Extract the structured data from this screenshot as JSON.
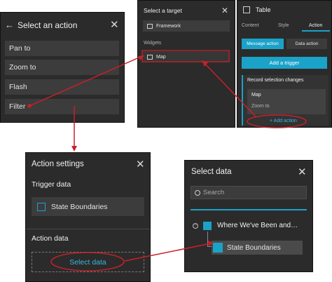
{
  "colors": {
    "panel_bg": "#2b2b2b",
    "accent": "#1ba2c9",
    "annotation": "#c8202a"
  },
  "select_action": {
    "title": "Select an action",
    "items": [
      "Pan to",
      "Zoom to",
      "Flash",
      "Filter"
    ]
  },
  "select_target": {
    "title": "Select a target",
    "framework_label": "Framework",
    "widgets_heading": "Widgets",
    "map_label": "Map"
  },
  "table_panel": {
    "title": "Table",
    "tabs": [
      "Content",
      "Style",
      "Action"
    ],
    "active_tab": "Action",
    "subtabs": [
      "Message action",
      "Data action"
    ],
    "add_trigger": "Add a trigger",
    "record_heading": "Record selection changes",
    "record_item_title": "Map",
    "record_item_sub": "Zoom to",
    "add_action": "+ Add action"
  },
  "action_settings": {
    "title": "Action settings",
    "trigger_heading": "Trigger data",
    "trigger_item": "State Boundaries",
    "action_heading": "Action data",
    "select_data": "Select data"
  },
  "select_data": {
    "title": "Select data",
    "search_placeholder": "Search",
    "tree_parent": "Where We've Been and…",
    "tree_child": "State Boundaries"
  }
}
